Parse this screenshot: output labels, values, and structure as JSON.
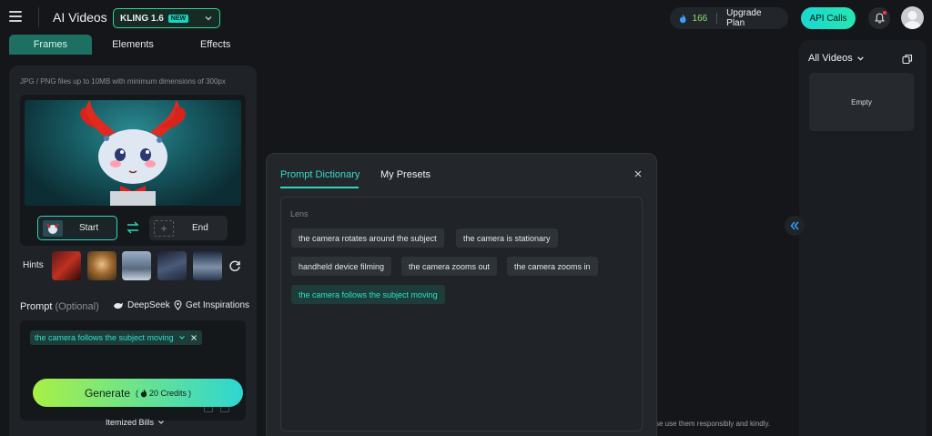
{
  "header": {
    "app_title": "AI Videos",
    "model": {
      "name": "KLING 1.6",
      "badge": "NEW"
    },
    "credits": "166",
    "upgrade_label": "Upgrade Plan",
    "api_label": "API Calls"
  },
  "left_panel": {
    "tabs": [
      {
        "label": "Frames",
        "active": true
      },
      {
        "label": "Elements",
        "active": false
      },
      {
        "label": "Effects",
        "active": false
      }
    ],
    "upload_hint": "JPG / PNG files up to 10MB with minimum dimensions of 300px",
    "start_label": "Start",
    "end_label": "End",
    "hints_label": "Hints",
    "prompt_label": "Prompt",
    "prompt_optional": "(Optional)",
    "deepseek_label": "DeepSeek",
    "inspirations_label": "Get Inspirations",
    "prompt_chip": "the camera follows the subject moving",
    "generate_label": "Generate",
    "generate_credits": "20 Credits",
    "itemized_label": "Itemized Bills"
  },
  "right_panel": {
    "all_videos_label": "All Videos",
    "empty_label": "Empty"
  },
  "dialog": {
    "tabs": [
      {
        "label": "Prompt Dictionary",
        "active": true
      },
      {
        "label": "My Presets",
        "active": false
      }
    ],
    "section_label": "Lens",
    "chips": [
      {
        "label": "the camera rotates around the subject",
        "selected": false
      },
      {
        "label": "the camera is stationary",
        "selected": false
      },
      {
        "label": "handheld device filming",
        "selected": false
      },
      {
        "label": "the camera zooms out",
        "selected": false
      },
      {
        "label": "the camera zooms in",
        "selected": false
      },
      {
        "label": "the camera follows the subject moving",
        "selected": true
      }
    ]
  },
  "disclaimer": "se use them responsibly and kindly.",
  "colors": {
    "accent": "#2fd6c0",
    "background": "#141619",
    "panel": "#1f2327",
    "generate_gradient_start": "#a8f046",
    "generate_gradient_end": "#2fd6d2"
  }
}
